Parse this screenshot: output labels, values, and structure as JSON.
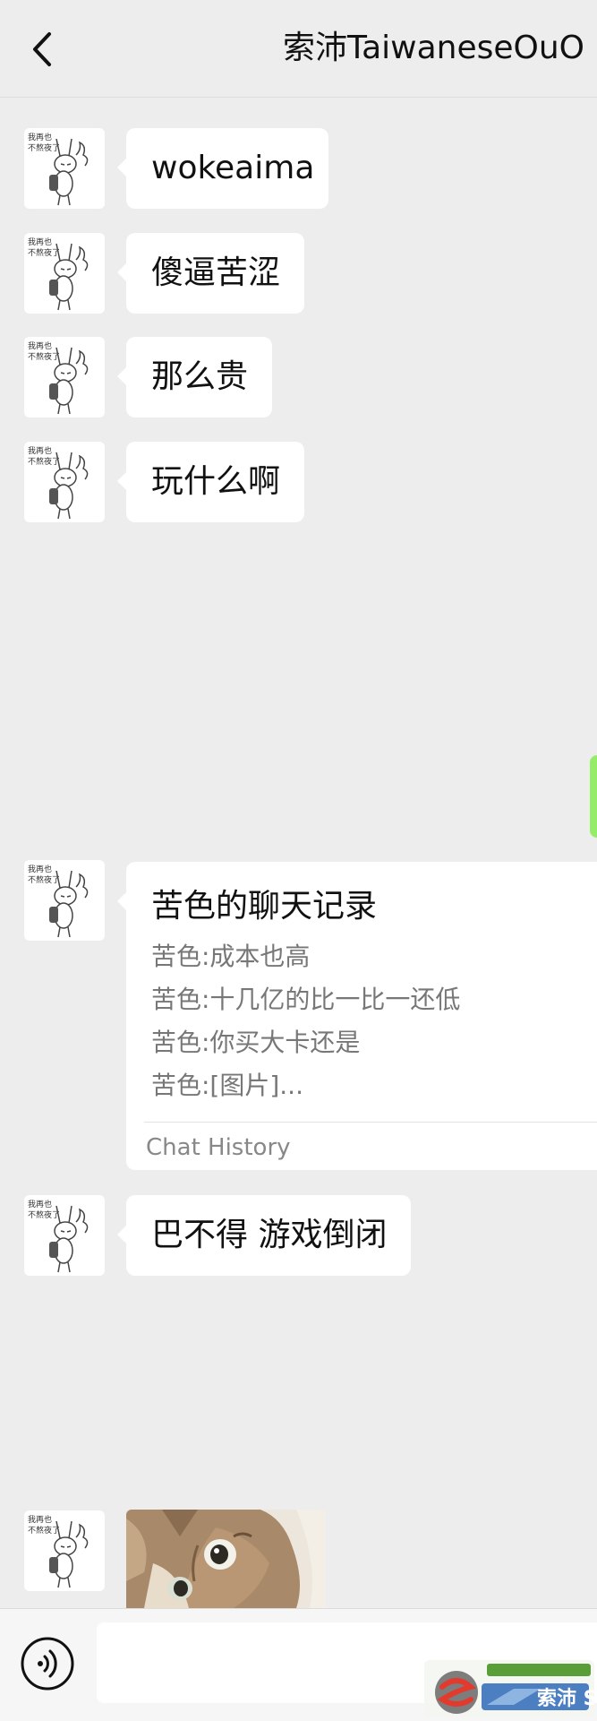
{
  "header": {
    "title": "索沛TaiwaneseOuO",
    "back_icon": "chevron-left-icon"
  },
  "avatar": {
    "text_line1": "我再也",
    "text_line2": "不熬夜了"
  },
  "messages": [
    {
      "type": "text",
      "text": "wokeaima"
    },
    {
      "type": "text",
      "text": "傻逼苦涩"
    },
    {
      "type": "text",
      "text": "那么贵"
    },
    {
      "type": "text",
      "text": "玩什么啊"
    },
    {
      "type": "chat_history",
      "title": "苦色的聊天记录",
      "lines": [
        "苦色:成本也高",
        "苦色:十几亿的比一比一还低",
        "苦色:你买大卡还是",
        "苦色:[图片]..."
      ],
      "footer": "Chat History"
    },
    {
      "type": "text",
      "text": "巴不得 游戏倒闭"
    },
    {
      "type": "image",
      "image": "cat-photo"
    }
  ],
  "input_bar": {
    "voice_icon": "voice-icon",
    "input_value": ""
  },
  "watermark": {
    "text": "索沛 S"
  },
  "colors": {
    "background": "#ededed",
    "bubble": "#ffffff",
    "accent_green": "#95ec69"
  }
}
